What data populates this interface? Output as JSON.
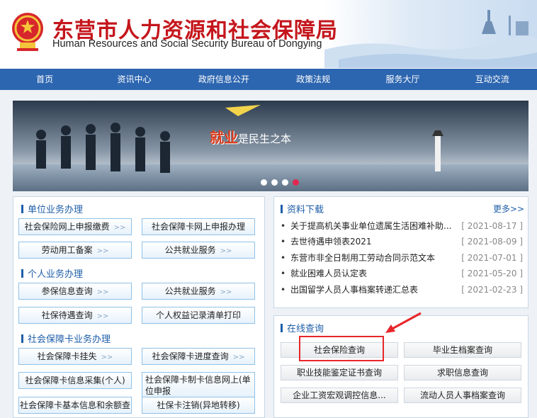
{
  "header": {
    "title_cn": "东营市人力资源和社会保障局",
    "title_en": "Human Resources and Social Security Bureau of Dongying"
  },
  "nav": [
    "首页",
    "资讯中心",
    "政府信息公开",
    "政策法规",
    "服务大厅",
    "互动交流"
  ],
  "banner": {
    "slogan_a": "就业",
    "slogan_b": "是民生之本",
    "active_dot": 4,
    "dot_count": 4
  },
  "left": {
    "sec1_title": "单位业务办理",
    "sec1_buttons": [
      "社会保险网上申报缴费",
      "社会保障卡网上申报办理",
      "劳动用工备案",
      "公共就业服务"
    ],
    "sec2_title": "个人业务办理",
    "sec2_buttons": [
      "参保信息查询",
      "公共就业服务",
      "社保待遇查询",
      "个人权益记录清单打印"
    ],
    "sec3_title": "社会保障卡业务办理",
    "sec3_buttons": [
      "社会保障卡挂失",
      "社会保障卡进度查询",
      "社会保障卡信息采集(个人)",
      "社会保障卡制卡信息网上(单位申报",
      "社会保障卡基本信息和余额查",
      "社保卡注销(异地转移)"
    ],
    "arrow_glyph": ">>"
  },
  "downloads": {
    "title": "资料下载",
    "more": "更多>>",
    "items": [
      {
        "title": "关于提高机关事业单位遗属生活困难补助...",
        "date": "[ 2021-08-17 ]"
      },
      {
        "title": "去世待遇申领表2021",
        "date": "[ 2021-08-09 ]"
      },
      {
        "title": "东营市非全日制用工劳动合同示范文本",
        "date": "[ 2021-07-01 ]"
      },
      {
        "title": "就业困难人员认定表",
        "date": "[ 2021-05-20 ]"
      },
      {
        "title": "出国留学人员人事档案转递汇总表",
        "date": "[ 2021-02-23 ]"
      }
    ]
  },
  "query": {
    "title": "在线查询",
    "buttons": [
      "社会保险查询",
      "毕业生档案查询",
      "职业技能鉴定证书查询",
      "求职信息查询",
      "企业工资宏观调控信息...",
      "流动人员人事档案查询"
    ]
  },
  "colors": {
    "nav": "#2d66b0",
    "title_red": "#c4161c",
    "highlight": "#e8262a"
  }
}
